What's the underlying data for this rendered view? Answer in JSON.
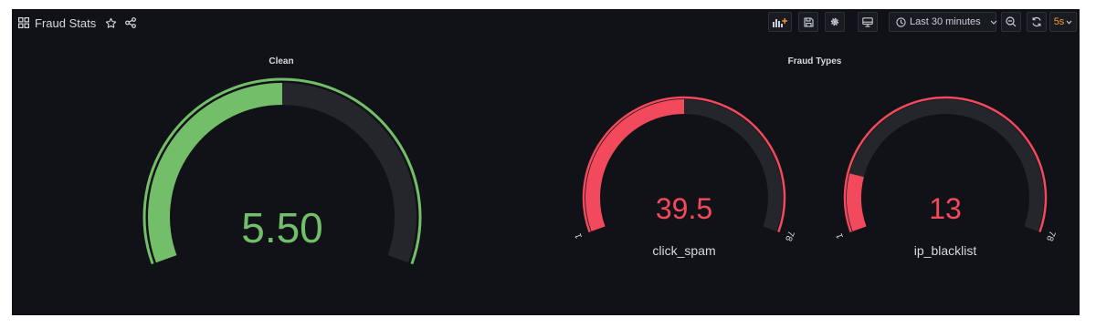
{
  "dashboard": {
    "title": "Fraud Stats"
  },
  "toolbar": {
    "time_range": "Last 30 minutes",
    "refresh_interval": "5s",
    "icons": {
      "add_panel": "add-panel-icon",
      "save": "save-icon",
      "settings": "gear-icon",
      "view_mode": "tv-monitor-icon",
      "time_picker": "clock-icon",
      "zoom_out": "zoom-out-icon",
      "refresh": "refresh-icon"
    }
  },
  "colors": {
    "background": "#111217",
    "track": "#25262c",
    "clean_accent": "#73bf69",
    "fraud_accent": "#f2495c",
    "refresh_accent": "#ff9830"
  },
  "panels": {
    "clean": {
      "title": "Clean",
      "gauges": [
        {
          "name": "",
          "value": 5.5,
          "display": "5.50",
          "min": 0,
          "max": 11,
          "color": "#73bf69",
          "show_min_max": false
        }
      ]
    },
    "fraud_types": {
      "title": "Fraud Types",
      "gauges": [
        {
          "name": "click_spam",
          "value": 39.5,
          "display": "39.5",
          "min": 1,
          "max": 78,
          "min_label": "1",
          "max_label": "78",
          "color": "#f2495c",
          "show_min_max": true
        },
        {
          "name": "ip_blacklist",
          "value": 13,
          "display": "13",
          "min": 1,
          "max": 78,
          "min_label": "1",
          "max_label": "78",
          "color": "#f2495c",
          "show_min_max": true
        }
      ]
    }
  }
}
